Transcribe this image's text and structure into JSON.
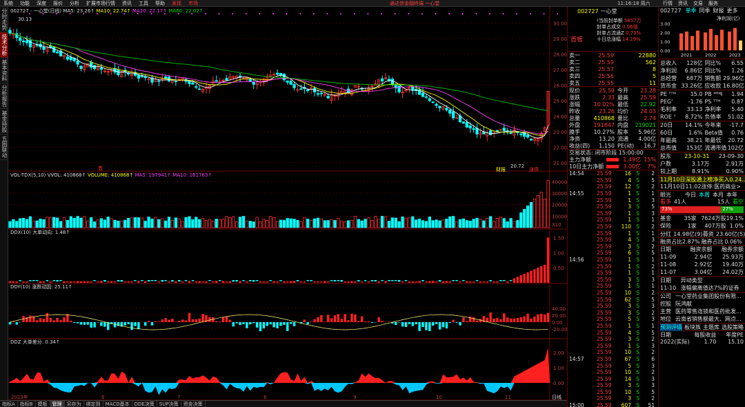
{
  "menu": {
    "items": [
      "系统",
      "功能",
      "深度",
      "报价",
      "分析",
      "扩展市场行情",
      "资讯",
      "工具",
      "帮助"
    ],
    "red_items": [
      "发现",
      "市场"
    ],
    "center_title": "通达信金融终端  一心堂",
    "clock": "11:16:18 周六",
    "right_tabs": [
      "行情",
      "资讯",
      "交易",
      "服务"
    ]
  },
  "left_tabs": [
    "分时走势",
    "技术分析",
    "基本资料",
    "分析报告",
    "基金持股",
    "五图联动"
  ],
  "chart": {
    "main_legend": {
      "code": "002727 - 一心堂(日线)",
      "ma5": "MA5: 23.26↑",
      "ma10": "MA10: 22.74↑",
      "ma20": "MA20: 22.17↑",
      "ma60": "MA60: 22.02↑"
    },
    "high_label": "30.13",
    "low_label": "20.72",
    "axis_main": [
      "30.00",
      "29.00",
      "28.00",
      "27.00",
      "26.00",
      "25.00",
      "24.00",
      "23.00",
      "22.00",
      "21.00"
    ],
    "event_labels": {
      "left": "首",
      "caibao": "财报",
      "zhangting": "涨停"
    },
    "vol_legend": {
      "name": "VOL-TDX(5,10)",
      "vvol": "VVOL: 410868↑",
      "volume": "VOLUME: 410868↑",
      "ma5": "MA5: 197941↑",
      "ma10": "MA10: 161763↑"
    },
    "axis_vol": [
      "40000",
      "30000",
      "20000",
      "10000",
      "X10"
    ],
    "ddx_legend": {
      "name": "DDX(10)",
      "val": "大单动向: 1.48↑"
    },
    "axis_ddx": [
      "1.50",
      "1.00",
      "0.50",
      "0.00"
    ],
    "ddy_legend": {
      "name": "DDY(10)",
      "val": "涨跌动因: 25.11↑"
    },
    "axis_ddy": [
      "40.00",
      "20.00",
      "0.00",
      "-20.00"
    ],
    "ddz_legend": {
      "name": "DDZ",
      "val": "大单差分: 0.34↑"
    },
    "axis_ddz": [
      "2.00",
      "1.00",
      "0.00"
    ],
    "x_labels": [
      "2023年",
      "6",
      "7",
      "8",
      "9",
      "10",
      "11"
    ],
    "x_right": "日线"
  },
  "bottom_tabs": [
    "指标A",
    "指标B",
    "模板",
    "管理",
    "另存为",
    "绑定到",
    "MACD基本",
    "DDE决策",
    "SUP决策",
    "资金决策"
  ],
  "orderbook": {
    "header": {
      "code": "002727",
      "name": "一心堂"
    },
    "seal": [
      [
        "!当前封单额",
        "5857万"
      ],
      [
        "封单占成交",
        "0.06倍"
      ],
      [
        "封单占流通Z",
        "0.73%"
      ],
      [
        "十日总涨幅",
        "14.29%"
      ]
    ],
    "tag": "首板",
    "asks": [
      [
        "卖一",
        "25.59",
        "22880"
      ],
      [
        "卖二",
        "25.59",
        "562"
      ],
      [
        "卖三",
        "25.57",
        "8"
      ],
      [
        "卖四",
        "25.56",
        "5"
      ],
      [
        "卖五",
        "25.55",
        "11"
      ]
    ],
    "stats": [
      [
        "现价",
        "25.59",
        "今开",
        "23.28"
      ],
      [
        "涨跌",
        "2.33",
        "最高",
        "25.59"
      ],
      [
        "涨幅",
        "10.02%",
        "最低",
        "22.92"
      ],
      [
        "昨收",
        "23.26",
        "均价",
        "24.03"
      ],
      [
        "总量",
        "410868",
        "量比",
        "2.74"
      ],
      [
        "外盘",
        "191847",
        "内盘",
        "219021"
      ],
      [
        "换手",
        "10.27%",
        "股本",
        "5.96亿"
      ],
      [
        "净资",
        "13.20",
        "流通",
        "4.00亿"
      ],
      [
        "收益(四)",
        "1.150",
        "PE(动)",
        "16.7"
      ]
    ],
    "status": "交易状态: 闭市阶段 15:00:00",
    "flows": [
      [
        "主力净额",
        "1.49亿",
        "15%"
      ],
      [
        "10日主力净额",
        "3.00亿",
        "7%"
      ]
    ],
    "times": [
      "14:54",
      "14:55",
      "14:56",
      "14:57",
      "15:00"
    ],
    "ticks": [
      [
        "25.59",
        "16",
        "S",
        "2"
      ],
      [
        "25.59",
        "4",
        "S",
        "5"
      ],
      [
        "25.59",
        "12",
        "S",
        "2"
      ],
      [
        "25.59",
        "1",
        "S",
        "1"
      ],
      [
        "25.59",
        "1",
        "S",
        "3"
      ],
      [
        "25.59",
        "3",
        "S",
        "5"
      ],
      [
        "25.59",
        "1",
        "S",
        "3"
      ],
      [
        "25.59",
        "1",
        "S",
        "1"
      ],
      [
        "25.59",
        "110",
        "S",
        "2"
      ],
      [
        "25.59",
        "1",
        "S",
        "1"
      ],
      [
        "25.59",
        "4",
        "S",
        "3"
      ],
      [
        "25.59",
        "3",
        "S",
        "2"
      ],
      [
        "25.59",
        "6",
        "S",
        "5"
      ],
      [
        "25.59",
        "1",
        "S",
        "1"
      ],
      [
        "25.59",
        "1",
        "S",
        "2"
      ],
      [
        "25.59",
        "1",
        "S",
        "1"
      ],
      [
        "25.59",
        "3",
        "S",
        "3"
      ],
      [
        "25.59",
        "1",
        "S",
        "1"
      ],
      [
        "25.59",
        "10",
        "S",
        "2"
      ],
      [
        "25.59",
        "62",
        "S",
        "5"
      ],
      [
        "25.59",
        "3",
        "S",
        "3"
      ],
      [
        "25.59",
        "3",
        "S",
        "2"
      ],
      [
        "25.59",
        "5",
        "S",
        "3"
      ],
      [
        "25.59",
        "1",
        "S",
        "1"
      ],
      [
        "25.59",
        "4",
        "S",
        "5"
      ],
      [
        "25.59",
        "3",
        "S",
        "2"
      ],
      [
        "25.59",
        "1",
        "S",
        "3"
      ],
      [
        "25.59",
        "10",
        "S",
        "2"
      ],
      [
        "25.59",
        "67",
        "S",
        "6"
      ],
      [
        "25.59",
        "5",
        "S",
        "3"
      ],
      [
        "25.59",
        "10",
        "S",
        "2"
      ],
      [
        "25.59",
        "14",
        "S",
        "3"
      ],
      [
        "25.59",
        "3",
        "S",
        "3"
      ],
      [
        "25.59",
        "10",
        "S",
        "5"
      ],
      [
        "25.59",
        "3",
        "S",
        "2"
      ],
      [
        "25.59",
        "607",
        "S",
        "51"
      ]
    ]
  },
  "right_panel": {
    "code": "002727",
    "tabs": [
      "单季",
      "同季",
      "财报",
      "更多"
    ],
    "bar_title": "净利润(亿)",
    "bar_axis": [
      "3.00",
      "2.00",
      "1.00",
      "0.00"
    ],
    "bar_years": [
      "2021",
      "2022",
      "2023"
    ],
    "bar_values": [
      1.9,
      2.1,
      1.6,
      2.2,
      2.0,
      2.4,
      1.7,
      2.3,
      2.1,
      2.5,
      1.1
    ],
    "fin": [
      [
        "总收入",
        "128亿",
        "同比%",
        "6.55"
      ],
      [
        "净利润",
        "6.86亿",
        "同比%",
        "1.26"
      ],
      [
        "总经营",
        "687万",
        "销售额",
        "29.96亿"
      ],
      [
        "货币金",
        "33.26亿",
        "应收款",
        "16.80亿"
      ]
    ],
    "val": [
      [
        "PE ᵀᵀᴹ",
        "15.0",
        "PB ᴹᴿᑫ",
        "1.94"
      ],
      [
        "PEG'",
        "-1.76",
        "PS ᵀᵀᴹ",
        "0.87"
      ],
      [
        "毛利率",
        "33.13",
        "净利率",
        "5.40"
      ],
      [
        "ROE ᵀ",
        "8.72%",
        "负债率",
        "51.02"
      ]
    ],
    "perf": [
      [
        "20日",
        "14.1%",
        "今年来",
        "-17.7"
      ],
      [
        "60日",
        "1.6%",
        "Beta值",
        "0.76"
      ],
      [
        "年最高",
        "38.21",
        "年最低",
        "20.72"
      ],
      [
        "总市值",
        "153亿",
        "流通市值",
        "102亿"
      ]
    ],
    "holders": [
      [
        "股东",
        "23-10-31",
        "",
        "23-09-30"
      ],
      [
        "户数",
        "3.17万",
        "",
        "2.91万"
      ],
      [
        "较上期",
        "8.91%",
        "",
        "0.90%"
      ]
    ],
    "news": "11月10日深股通上榜净买入0.24...",
    "news2": "11月10日11:02涨停:医药商业>",
    "eye": {
      "label": "眼光",
      "tabs": [
        "今日",
        "本周",
        "本月",
        "本年"
      ]
    },
    "sentiment": {
      "bull_label": "看多",
      "bull_count": "41人",
      "bear_count": "15人",
      "bear_label": "看空",
      "bull_pct": "73%",
      "bear_pct": "27%"
    },
    "funds": [
      [
        "基金",
        "35家",
        "7624万股",
        "19.1%"
      ],
      [
        "保险",
        "1家",
        "407万股",
        "1.0%"
      ]
    ],
    "dividend": [
      "分红",
      "14.98亿(9)",
      "募资",
      "23.60亿(5)"
    ],
    "margin": [
      "融资占比",
      "2.87%",
      "融券占比",
      "0.06%"
    ],
    "margin_table": {
      "head": [
        "日期",
        "融资余额",
        "融券余额"
      ],
      "rows": [
        [
          "11-09",
          "2.94亿",
          "25.93万"
        ],
        [
          "11-08",
          "2.92亿",
          "19.40万"
        ],
        [
          "11-07",
          "3.04亿",
          "24.02万"
        ]
      ]
    },
    "anomaly": {
      "head": [
        "日期",
        "异动类型"
      ],
      "rows": [
        [
          "11-10",
          "涨幅偏离值达7%的证券"
        ]
      ]
    },
    "company": [
      [
        "公司",
        "一心堂药业集团股份有限..."
      ],
      [
        "控股",
        "阮鸿献"
      ],
      [
        "主营",
        "医药零售连锁和医药批发..."
      ],
      [
        "地位",
        "云南省销售额最大、网点..."
      ]
    ],
    "links": [
      "预测评级",
      "板块族",
      "主题库",
      "选股策略"
    ],
    "eps_head": [
      "日期",
      "每股收益",
      "年度PE"
    ],
    "eps_row": [
      "2022(实际)",
      "1.70",
      "15.10"
    ]
  }
}
